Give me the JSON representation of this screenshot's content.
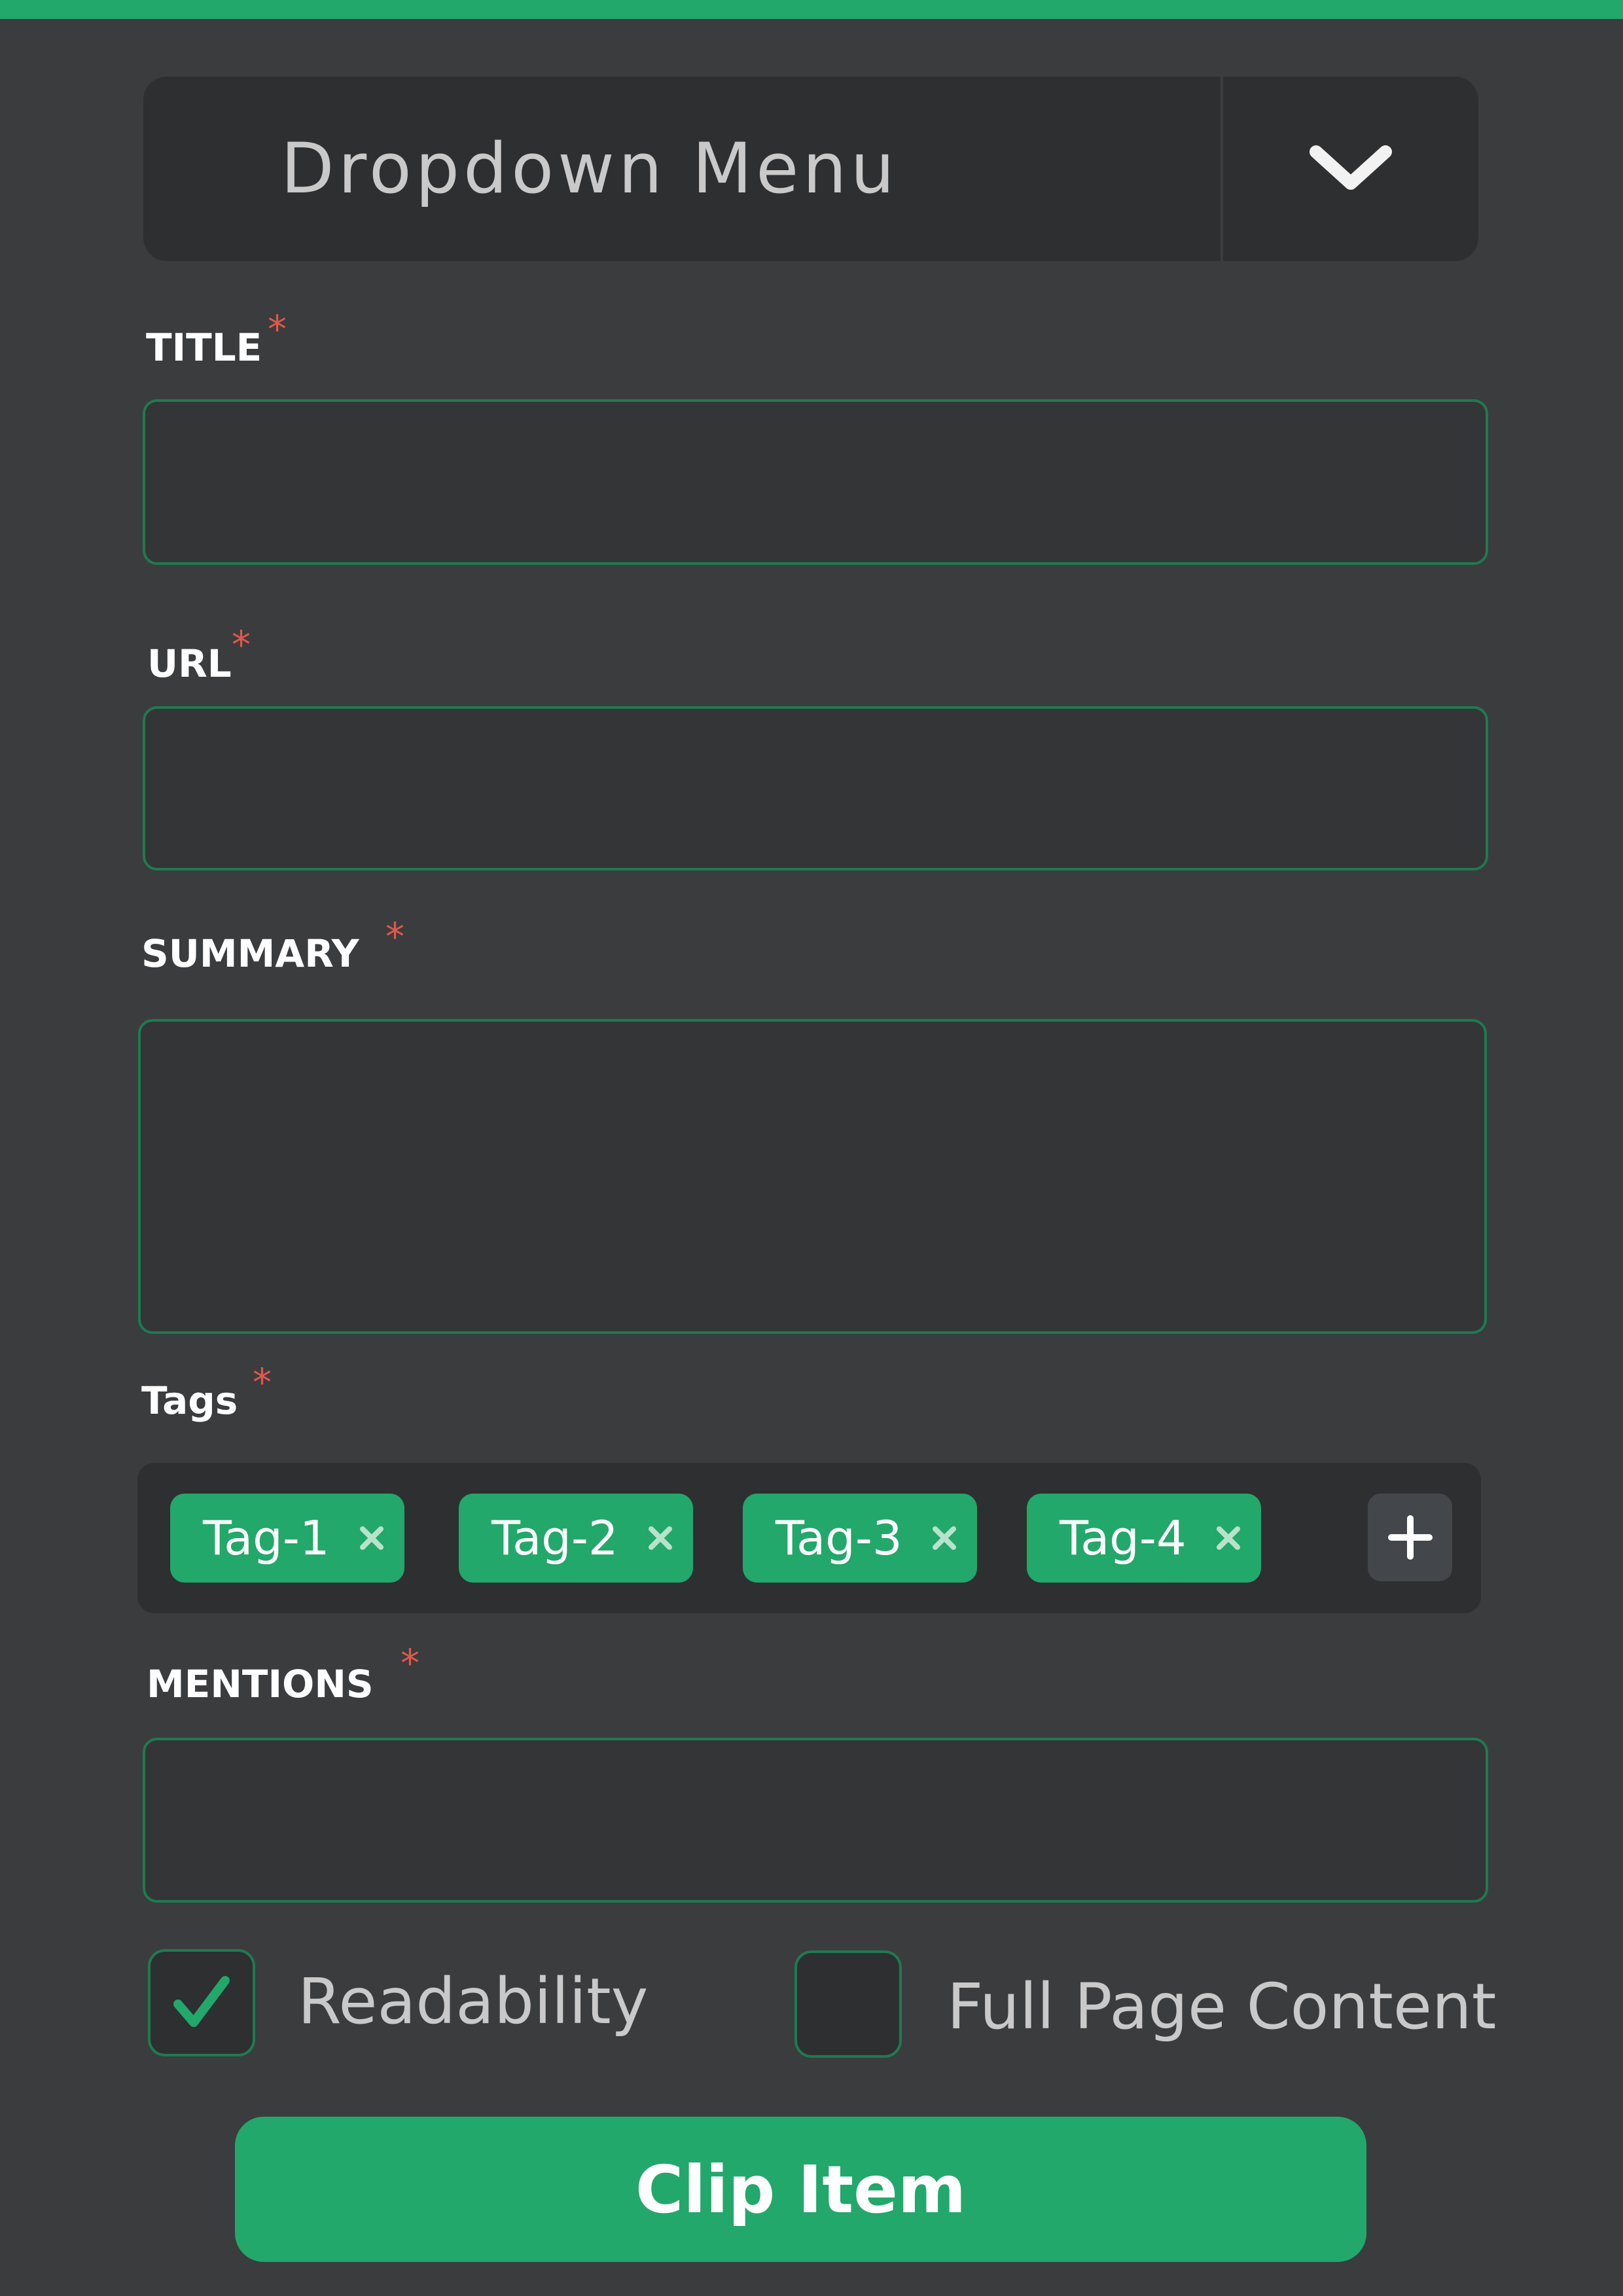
{
  "colors": {
    "accent": "#22a86a",
    "panel_background": "#3b3c3e",
    "input_background": "#343537",
    "input_border": "#1f7a52",
    "required_mark": "#e0584c"
  },
  "dropdown": {
    "label": "Dropdown Menu",
    "toggle_icon": "chevron-down-icon"
  },
  "fields": {
    "title": {
      "label": "TITLE",
      "required_mark": "*",
      "value": "",
      "placeholder": ""
    },
    "url": {
      "label": "URL",
      "required_mark": "*",
      "value": "",
      "placeholder": ""
    },
    "summary": {
      "label": "SUMMARY",
      "required_mark": "*",
      "value": "",
      "placeholder": ""
    },
    "mentions": {
      "label": "MENTIONS",
      "required_mark": "*",
      "value": "",
      "placeholder": ""
    }
  },
  "tags": {
    "label": "Tags",
    "required_mark": "*",
    "items": [
      {
        "label": "Tag-1"
      },
      {
        "label": "Tag-2"
      },
      {
        "label": "Tag-3"
      },
      {
        "label": "Tag-4"
      }
    ],
    "remove_icon": "close-icon",
    "add_icon": "plus-icon"
  },
  "options": {
    "readability": {
      "label": "Readability",
      "checked": true
    },
    "full_page_content": {
      "label": "Full Page Content",
      "checked": false
    }
  },
  "submit": {
    "label": "Clip Item"
  }
}
